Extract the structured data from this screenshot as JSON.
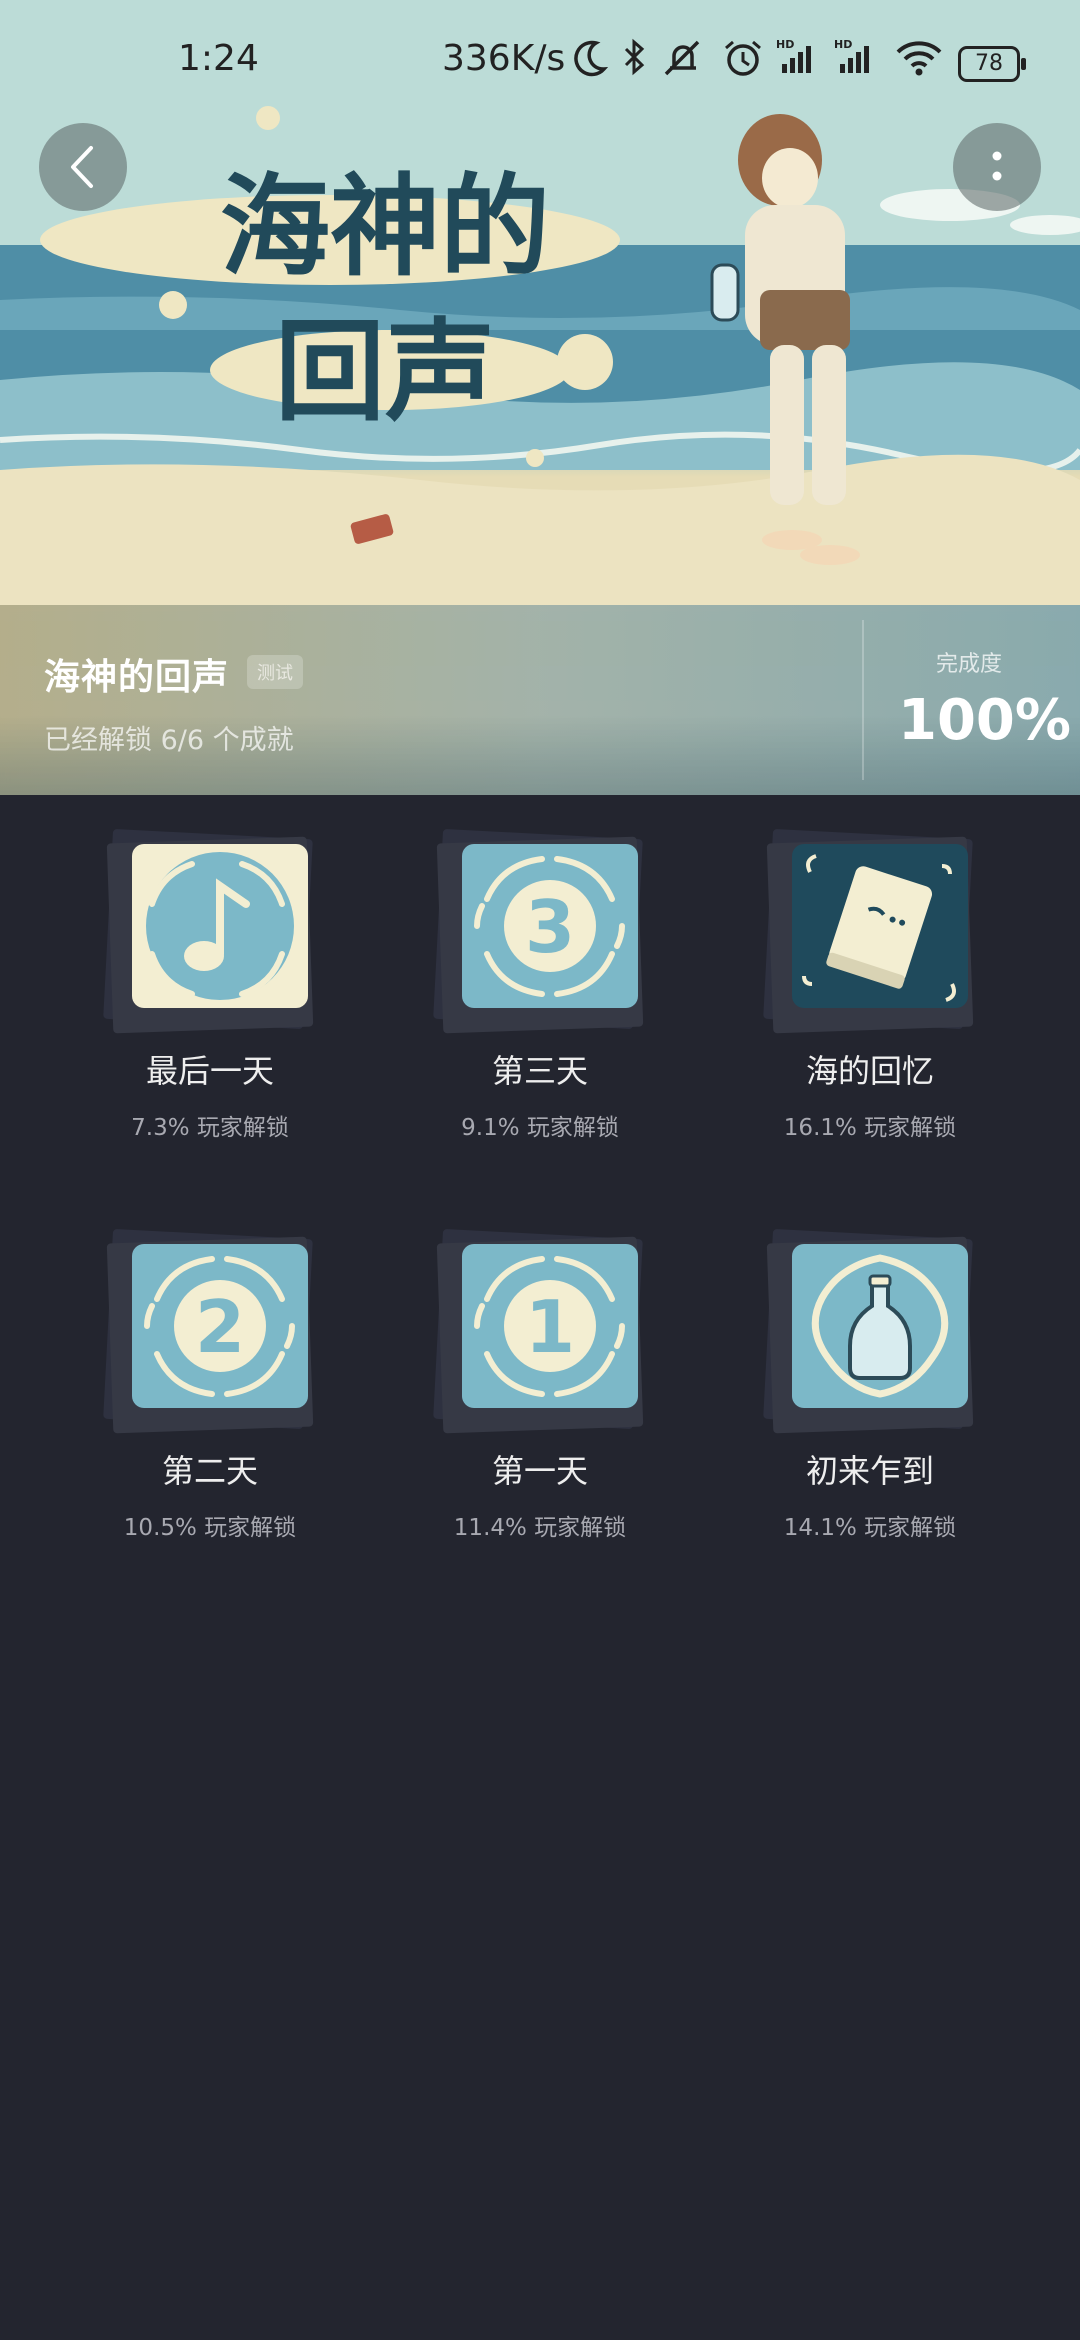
{
  "status_bar": {
    "time": "1:24",
    "speed": "336K/s",
    "battery": "78"
  },
  "header": {
    "game_title": "海神的回声",
    "badge": "测试",
    "unlock_summary": "已经解锁 6/6 个成就",
    "completion_label": "完成度",
    "completion_value": "100%",
    "art_title_line1": "海神的",
    "art_title_line2": "回声"
  },
  "achievements": [
    {
      "name": "最后一天",
      "unlock_rate": "7.3% 玩家解锁",
      "icon": "music-note-icon"
    },
    {
      "name": "第三天",
      "unlock_rate": "9.1% 玩家解锁",
      "icon": "number-3-icon"
    },
    {
      "name": "海的回忆",
      "unlock_rate": "16.1% 玩家解锁",
      "icon": "book-icon"
    },
    {
      "name": "第二天",
      "unlock_rate": "10.5% 玩家解锁",
      "icon": "number-2-icon"
    },
    {
      "name": "第一天",
      "unlock_rate": "11.4% 玩家解锁",
      "icon": "number-1-icon"
    },
    {
      "name": "初来乍到",
      "unlock_rate": "14.1% 玩家解锁",
      "icon": "bottle-icon"
    }
  ],
  "colors": {
    "background": "#23252f",
    "tile_blue": "#7cb8c8",
    "tile_cream": "#f3eed2",
    "tile_dark": "#1f4a5c"
  }
}
